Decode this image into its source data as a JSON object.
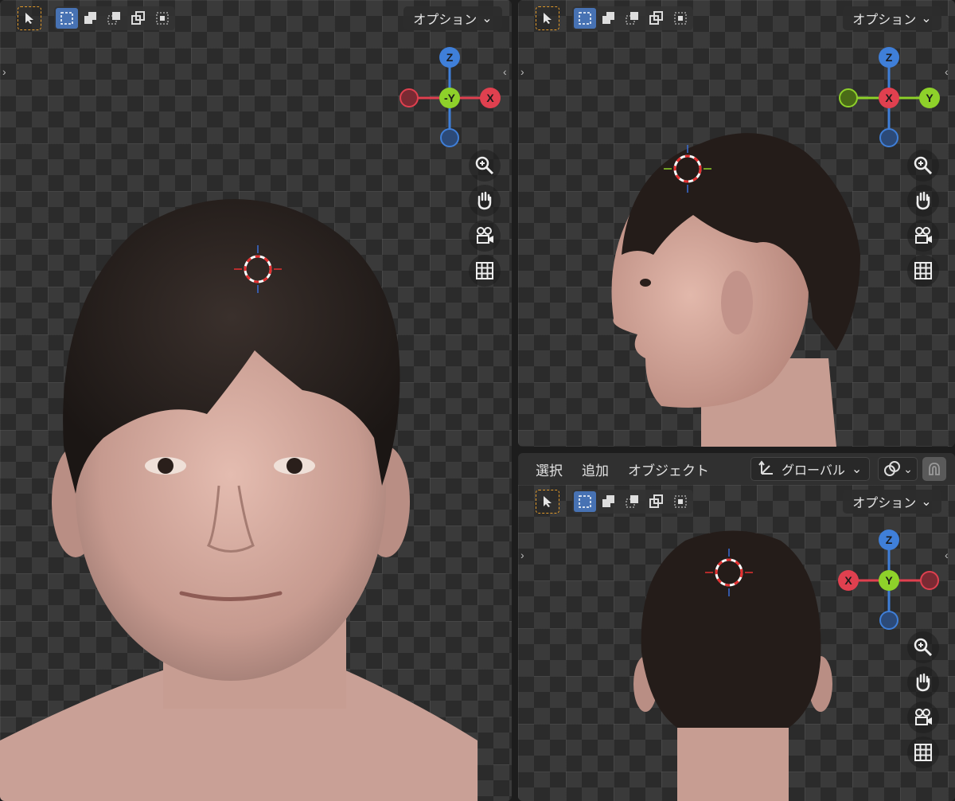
{
  "header_menu": {
    "select": "選択",
    "add": "追加",
    "object": "オブジェクト",
    "orientation": "グローバル"
  },
  "options_label": "オプション",
  "gizmos": {
    "front": {
      "top": "Z",
      "center": "-Y",
      "right": "X"
    },
    "side": {
      "top": "Z",
      "center": "X",
      "right": "Y"
    },
    "back": {
      "top": "Z",
      "center": "Y",
      "left": "X"
    }
  },
  "colors": {
    "x_axis": "#e0404f",
    "y_axis": "#8ed12a",
    "z_axis": "#3f7fd9",
    "active_mode": "#4772b3",
    "select_tool": "#e29a2a"
  },
  "icons": [
    "select-cursor-icon",
    "zoom-icon",
    "pan-hand-icon",
    "camera-icon",
    "grid-icon",
    "transform-orientation-icon",
    "snap-icon",
    "magnet-icon"
  ]
}
